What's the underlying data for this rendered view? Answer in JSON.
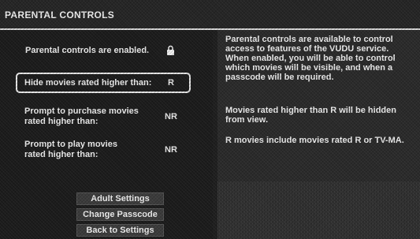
{
  "header": {
    "title": "PARENTAL CONTROLS"
  },
  "status": {
    "text": "Parental controls are enabled.",
    "icon": "lock-icon"
  },
  "settings": [
    {
      "label": "Hide movies rated higher than:",
      "value": "R"
    },
    {
      "label": "Prompt to purchase movies rated higher than:",
      "value": "NR"
    },
    {
      "label": "Prompt to play movies rated higher than:",
      "value": "NR"
    }
  ],
  "buttons": {
    "adult": "Adult Settings",
    "passcode": "Change Passcode",
    "back": "Back to Settings"
  },
  "info": {
    "intro": "Parental controls are available to control access to features of the VUDU service. When enabled, you will be able to control which movies will be visible, and when a passcode will be required.",
    "hidden": "Movies rated higher than R will be hidden from view.",
    "includes": "R movies include movies rated R or TV-MA."
  }
}
